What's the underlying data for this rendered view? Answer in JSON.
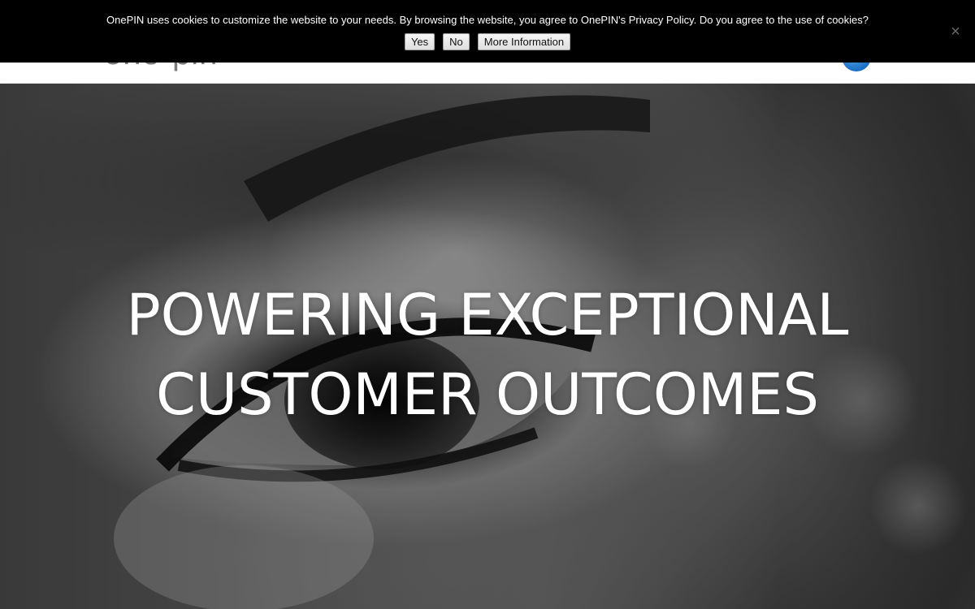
{
  "header": {
    "logo_text": "one-pin",
    "globe_icon": "globe-icon"
  },
  "cookie_bar": {
    "message": "OnePIN uses cookies to customize the website to your needs. By browsing the website, you agree to OnePIN's Privacy Policy. Do you agree to the use of cookies?",
    "yes_label": "Yes",
    "no_label": "No",
    "more_label": "More Information",
    "close_label": "×",
    "close_icon": "close-icon",
    "background_color": "#000000"
  },
  "hero": {
    "title_line1": "POWERING EXCEPTIONAL",
    "title_line2": "CUSTOMER OUTCOMES",
    "image": "close-up-eye-monochrome-photo"
  }
}
